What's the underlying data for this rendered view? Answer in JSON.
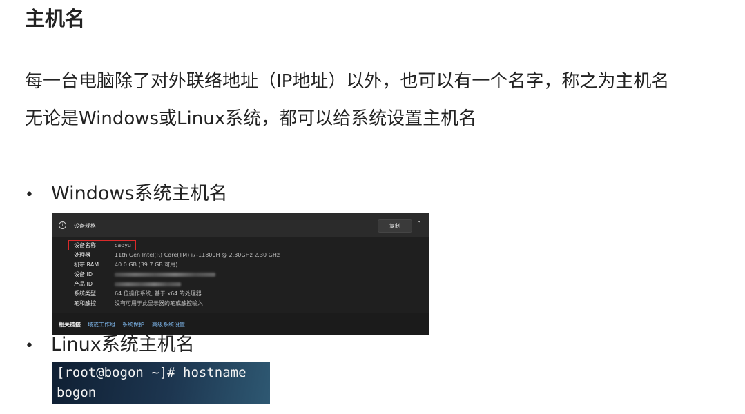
{
  "title": "主机名",
  "paragraphs": [
    "每一台电脑除了对外联络地址（IP地址）以外，也可以有一个名字，称之为主机名",
    "无论是Windows或Linux系统，都可以给系统设置主机名"
  ],
  "bullets": {
    "marker": "•",
    "windows": "Windows系统主机名",
    "linux": "Linux系统主机名"
  },
  "windows_panel": {
    "header_title": "设备规格",
    "info_icon": "info-icon",
    "copy_label": "复制",
    "chevron": "⌃",
    "rows": [
      {
        "key": "设备名称",
        "value": "caoyu"
      },
      {
        "key": "处理器",
        "value": "11th Gen Intel(R) Core(TM) i7-11800H @ 2.30GHz   2.30 GHz"
      },
      {
        "key": "机带 RAM",
        "value": "40.0 GB (39.7 GB 可用)"
      },
      {
        "key": "设备 ID",
        "value": ""
      },
      {
        "key": "产品 ID",
        "value": ""
      },
      {
        "key": "系统类型",
        "value": "64 位操作系统, 基于 x64 的处理器"
      },
      {
        "key": "笔和触控",
        "value": "没有可用于此显示器的笔或触控输入"
      }
    ],
    "footer": {
      "label": "相关链接",
      "links": [
        "域或工作组",
        "系统保护",
        "高级系统设置"
      ]
    },
    "highlight_color": "#d92a2a",
    "link_color": "#7fb8ee"
  },
  "terminal": {
    "prompt_line": "[root@bogon ~]# hostname",
    "output_line": "bogon"
  }
}
